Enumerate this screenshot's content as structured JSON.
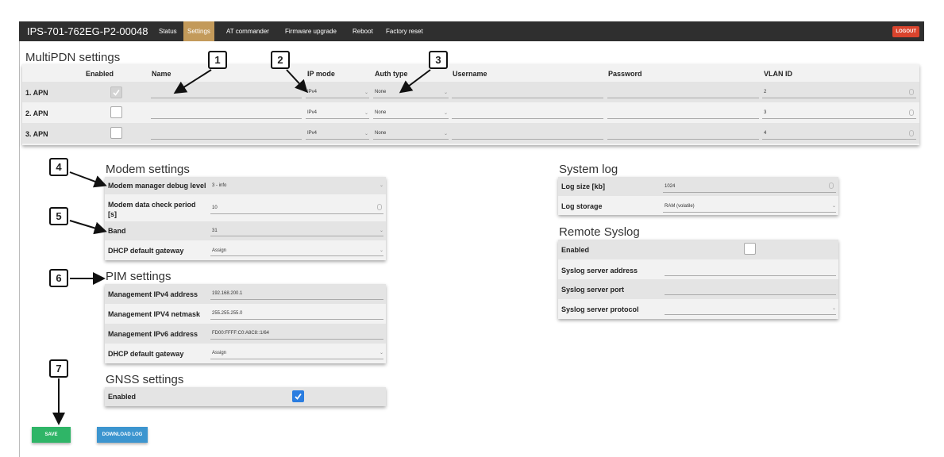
{
  "header": {
    "device_name": "IPS-701-762EG-P2-00048",
    "nav": [
      "Status",
      "Settings",
      "AT commander",
      "Firmware upgrade",
      "Reboot",
      "Factory reset"
    ],
    "logout": "LOGOUT"
  },
  "multipdn": {
    "title": "MultiPDN settings",
    "columns": [
      "Enabled",
      "Name",
      "IP mode",
      "Auth type",
      "Username",
      "Password",
      "VLAN ID"
    ],
    "rows": [
      {
        "label": "1. APN",
        "enabled": true,
        "ip_mode": "IPv4",
        "auth": "None",
        "vlan": "2"
      },
      {
        "label": "2. APN",
        "enabled": false,
        "ip_mode": "IPv4",
        "auth": "None",
        "vlan": "3"
      },
      {
        "label": "3. APN",
        "enabled": false,
        "ip_mode": "IPv4",
        "auth": "None",
        "vlan": "4"
      }
    ]
  },
  "modem": {
    "title": "Modem settings",
    "rows": [
      {
        "label": "Modem manager debug level",
        "value": "3 - info"
      },
      {
        "label": "Modem data check period [s]",
        "value": "10"
      },
      {
        "label": "Band",
        "value": "31"
      },
      {
        "label": "DHCP default gateway",
        "value": "Assign"
      }
    ]
  },
  "pim": {
    "title": "PIM settings",
    "rows": [
      {
        "label": "Management IPv4 address",
        "value": "192.168.200.1"
      },
      {
        "label": "Management IPV4 netmask",
        "value": "255.255.255.0"
      },
      {
        "label": "Management IPv6 address",
        "value": "FD00:FFFF:C0:A8C8::1/64"
      },
      {
        "label": "DHCP default gateway",
        "value": "Assign"
      }
    ]
  },
  "gnss": {
    "title": "GNSS settings",
    "enabled_label": "Enabled",
    "enabled": true
  },
  "syslog": {
    "title": "System log",
    "rows": [
      {
        "label": "Log size [kb]",
        "value": "1024"
      },
      {
        "label": "Log storage",
        "value": "RAM (volatile)"
      }
    ]
  },
  "remote_syslog": {
    "title": "Remote Syslog",
    "rows": [
      {
        "label": "Enabled"
      },
      {
        "label": "Syslog server address"
      },
      {
        "label": "Syslog server port"
      },
      {
        "label": "Syslog server protocol"
      }
    ]
  },
  "buttons": {
    "save": "SAVE",
    "download_log": "DOWNLOAD LOG"
  },
  "callouts": [
    "1",
    "2",
    "3",
    "4",
    "5",
    "6",
    "7"
  ],
  "colors": {
    "navbar": "#2f2f2f",
    "active_tab": "#c39a5a",
    "logout": "#d9442d",
    "save": "#2fb567",
    "download": "#3c95cf",
    "checkbox_checked": "#2b7de0"
  }
}
